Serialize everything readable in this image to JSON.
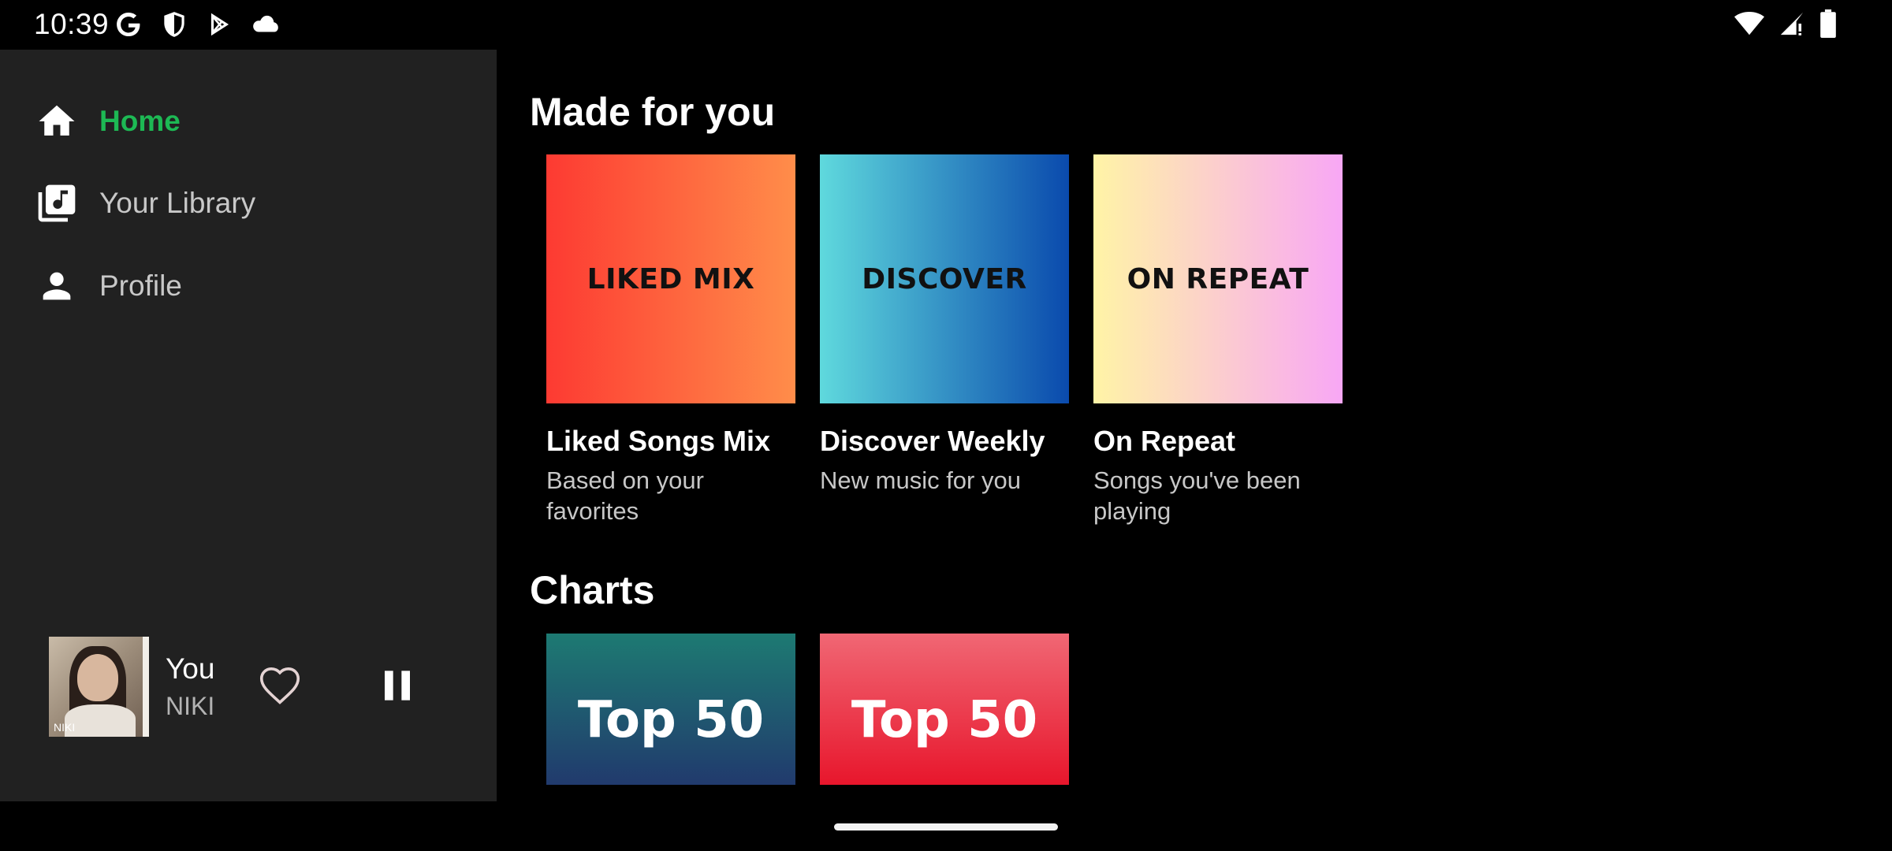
{
  "status_bar": {
    "time": "10:39",
    "left_icons": [
      "google-icon",
      "shield-icon",
      "play-store-icon",
      "cloud-icon"
    ],
    "right_icons": [
      "wifi-icon",
      "signal-icon",
      "battery-icon"
    ]
  },
  "sidebar": {
    "nav": [
      {
        "label": "Home",
        "icon": "home-icon",
        "active": true
      },
      {
        "label": "Your Library",
        "icon": "library-icon",
        "active": false
      },
      {
        "label": "Profile",
        "icon": "person-icon",
        "active": false
      }
    ],
    "now_playing": {
      "title": "You",
      "artist": "NIKI",
      "art_text": "NIKI",
      "like_icon": "heart-outline-icon",
      "control_icon": "pause-icon"
    }
  },
  "main": {
    "made_for_you": {
      "title": "Made for you",
      "cards": [
        {
          "cover_label": "LIKED MIX",
          "name": "Liked Songs Mix",
          "description": "Based on your favorites"
        },
        {
          "cover_label": "DISCOVER",
          "name": "Discover Weekly",
          "description": "New music for you"
        },
        {
          "cover_label": "ON REPEAT",
          "name": "On Repeat",
          "description": "Songs you've been playing"
        }
      ]
    },
    "charts": {
      "title": "Charts",
      "cards": [
        {
          "label": "Top 50"
        },
        {
          "label": "Top 50"
        }
      ]
    }
  },
  "colors": {
    "accent": "#1db954",
    "sidebar_bg": "#212121",
    "background": "#000000"
  }
}
